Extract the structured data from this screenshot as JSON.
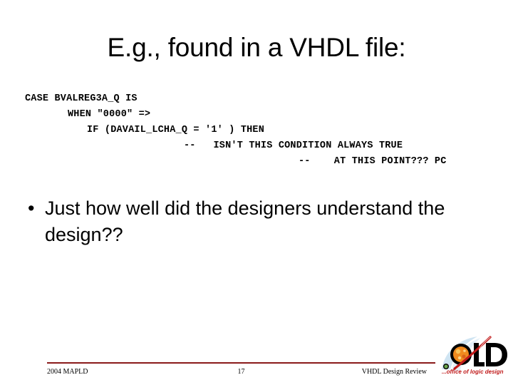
{
  "slide": {
    "title": "E.g., found in a VHDL file:",
    "code_lines": [
      "CASE BVALREG3A_Q IS",
      "WHEN \"0000\" =>",
      "IF (DAVAIL_LCHA_Q = '1' ) THEN",
      "--   ISN'T THIS CONDITION ALWAYS TRUE",
      "--    AT THIS POINT??? PC"
    ],
    "bullets": [
      {
        "marker": "•",
        "text": "Just how well did the designers understand the design??"
      }
    ]
  },
  "footer": {
    "left": "2004 MAPLD",
    "page_number": "17",
    "right": "VHDL Design Review",
    "rule_color": "#8a1a1a"
  },
  "logo": {
    "wordmark": "OLD",
    "tagline": "...office of logic design",
    "letter_color": "#000000",
    "tagline_color": "#c01a1a",
    "planet_color": "#f08a1e",
    "swoosh_color": "#cfe4f2",
    "arc_color": "#c01a1a"
  }
}
